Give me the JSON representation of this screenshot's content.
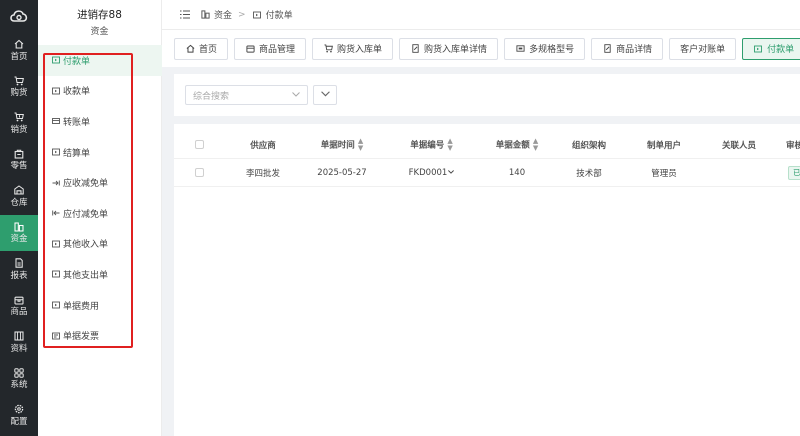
{
  "rail": {
    "items": [
      {
        "label": "首页",
        "icon": "home-icon"
      },
      {
        "label": "购货",
        "icon": "cart-icon"
      },
      {
        "label": "销货",
        "icon": "cart-out-icon"
      },
      {
        "label": "零售",
        "icon": "retail-icon"
      },
      {
        "label": "仓库",
        "icon": "warehouse-icon"
      },
      {
        "label": "资金",
        "icon": "funds-icon",
        "active": true
      },
      {
        "label": "报表",
        "icon": "report-icon"
      },
      {
        "label": "商品",
        "icon": "goods-icon"
      },
      {
        "label": "资料",
        "icon": "data-icon"
      },
      {
        "label": "系统",
        "icon": "system-icon"
      },
      {
        "label": "配置",
        "icon": "config-icon"
      }
    ]
  },
  "submenu": {
    "app_title": "进销存88",
    "section": "资金",
    "items": [
      {
        "label": "付款单",
        "icon": "document-icon",
        "active": true
      },
      {
        "label": "收款单",
        "icon": "document-icon"
      },
      {
        "label": "转账单",
        "icon": "transfer-icon"
      },
      {
        "label": "结算单",
        "icon": "document-icon"
      },
      {
        "label": "应收减免单",
        "icon": "arrow-in-icon"
      },
      {
        "label": "应付减免单",
        "icon": "arrow-out-icon"
      },
      {
        "label": "其他收入单",
        "icon": "document-icon"
      },
      {
        "label": "其他支出单",
        "icon": "document-icon"
      },
      {
        "label": "单据费用",
        "icon": "document-icon"
      },
      {
        "label": "单据发票",
        "icon": "invoice-icon"
      }
    ]
  },
  "breadcrumb": {
    "parent": "资金",
    "current": "付款单"
  },
  "tabs": [
    {
      "label": "首页",
      "icon": "home-icon"
    },
    {
      "label": "商品管理",
      "icon": "goods-icon"
    },
    {
      "label": "购货入库单",
      "icon": "cart-icon"
    },
    {
      "label": "购货入库单详情",
      "icon": "edit-doc-icon"
    },
    {
      "label": "多规格型号",
      "icon": "spec-icon"
    },
    {
      "label": "商品详情",
      "icon": "edit-doc-icon"
    },
    {
      "label": "客户对账单",
      "icon": ""
    },
    {
      "label": "付款单",
      "icon": "document-icon",
      "active": true
    }
  ],
  "search": {
    "placeholder": "综合搜索"
  },
  "table": {
    "columns": [
      "供应商",
      "单据时间",
      "单据编号",
      "单据金额",
      "组织架构",
      "制单用户",
      "关联人员",
      "审核"
    ],
    "rows": [
      {
        "supplier": "李四批发",
        "date": "2025-05-27",
        "number": "FKD0001",
        "amount": "140",
        "org": "技术部",
        "creator": "管理员",
        "related": "",
        "status": "已"
      }
    ]
  },
  "colors": {
    "accent": "#2e9e6e",
    "rail_bg": "#23272b",
    "highlight_box": "#e02020"
  }
}
